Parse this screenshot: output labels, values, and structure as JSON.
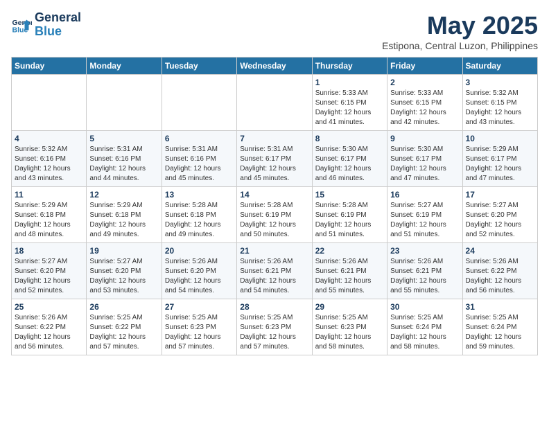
{
  "logo": {
    "line1": "General",
    "line2": "Blue"
  },
  "title": {
    "month_year": "May 2025",
    "location": "Estipona, Central Luzon, Philippines"
  },
  "header": {
    "days": [
      "Sunday",
      "Monday",
      "Tuesday",
      "Wednesday",
      "Thursday",
      "Friday",
      "Saturday"
    ]
  },
  "weeks": [
    [
      {
        "day": "",
        "info": ""
      },
      {
        "day": "",
        "info": ""
      },
      {
        "day": "",
        "info": ""
      },
      {
        "day": "",
        "info": ""
      },
      {
        "day": "1",
        "info": "Sunrise: 5:33 AM\nSunset: 6:15 PM\nDaylight: 12 hours\nand 41 minutes."
      },
      {
        "day": "2",
        "info": "Sunrise: 5:33 AM\nSunset: 6:15 PM\nDaylight: 12 hours\nand 42 minutes."
      },
      {
        "day": "3",
        "info": "Sunrise: 5:32 AM\nSunset: 6:15 PM\nDaylight: 12 hours\nand 43 minutes."
      }
    ],
    [
      {
        "day": "4",
        "info": "Sunrise: 5:32 AM\nSunset: 6:16 PM\nDaylight: 12 hours\nand 43 minutes."
      },
      {
        "day": "5",
        "info": "Sunrise: 5:31 AM\nSunset: 6:16 PM\nDaylight: 12 hours\nand 44 minutes."
      },
      {
        "day": "6",
        "info": "Sunrise: 5:31 AM\nSunset: 6:16 PM\nDaylight: 12 hours\nand 45 minutes."
      },
      {
        "day": "7",
        "info": "Sunrise: 5:31 AM\nSunset: 6:17 PM\nDaylight: 12 hours\nand 45 minutes."
      },
      {
        "day": "8",
        "info": "Sunrise: 5:30 AM\nSunset: 6:17 PM\nDaylight: 12 hours\nand 46 minutes."
      },
      {
        "day": "9",
        "info": "Sunrise: 5:30 AM\nSunset: 6:17 PM\nDaylight: 12 hours\nand 47 minutes."
      },
      {
        "day": "10",
        "info": "Sunrise: 5:29 AM\nSunset: 6:17 PM\nDaylight: 12 hours\nand 47 minutes."
      }
    ],
    [
      {
        "day": "11",
        "info": "Sunrise: 5:29 AM\nSunset: 6:18 PM\nDaylight: 12 hours\nand 48 minutes."
      },
      {
        "day": "12",
        "info": "Sunrise: 5:29 AM\nSunset: 6:18 PM\nDaylight: 12 hours\nand 49 minutes."
      },
      {
        "day": "13",
        "info": "Sunrise: 5:28 AM\nSunset: 6:18 PM\nDaylight: 12 hours\nand 49 minutes."
      },
      {
        "day": "14",
        "info": "Sunrise: 5:28 AM\nSunset: 6:19 PM\nDaylight: 12 hours\nand 50 minutes."
      },
      {
        "day": "15",
        "info": "Sunrise: 5:28 AM\nSunset: 6:19 PM\nDaylight: 12 hours\nand 51 minutes."
      },
      {
        "day": "16",
        "info": "Sunrise: 5:27 AM\nSunset: 6:19 PM\nDaylight: 12 hours\nand 51 minutes."
      },
      {
        "day": "17",
        "info": "Sunrise: 5:27 AM\nSunset: 6:20 PM\nDaylight: 12 hours\nand 52 minutes."
      }
    ],
    [
      {
        "day": "18",
        "info": "Sunrise: 5:27 AM\nSunset: 6:20 PM\nDaylight: 12 hours\nand 52 minutes."
      },
      {
        "day": "19",
        "info": "Sunrise: 5:27 AM\nSunset: 6:20 PM\nDaylight: 12 hours\nand 53 minutes."
      },
      {
        "day": "20",
        "info": "Sunrise: 5:26 AM\nSunset: 6:20 PM\nDaylight: 12 hours\nand 54 minutes."
      },
      {
        "day": "21",
        "info": "Sunrise: 5:26 AM\nSunset: 6:21 PM\nDaylight: 12 hours\nand 54 minutes."
      },
      {
        "day": "22",
        "info": "Sunrise: 5:26 AM\nSunset: 6:21 PM\nDaylight: 12 hours\nand 55 minutes."
      },
      {
        "day": "23",
        "info": "Sunrise: 5:26 AM\nSunset: 6:21 PM\nDaylight: 12 hours\nand 55 minutes."
      },
      {
        "day": "24",
        "info": "Sunrise: 5:26 AM\nSunset: 6:22 PM\nDaylight: 12 hours\nand 56 minutes."
      }
    ],
    [
      {
        "day": "25",
        "info": "Sunrise: 5:26 AM\nSunset: 6:22 PM\nDaylight: 12 hours\nand 56 minutes."
      },
      {
        "day": "26",
        "info": "Sunrise: 5:25 AM\nSunset: 6:22 PM\nDaylight: 12 hours\nand 57 minutes."
      },
      {
        "day": "27",
        "info": "Sunrise: 5:25 AM\nSunset: 6:23 PM\nDaylight: 12 hours\nand 57 minutes."
      },
      {
        "day": "28",
        "info": "Sunrise: 5:25 AM\nSunset: 6:23 PM\nDaylight: 12 hours\nand 57 minutes."
      },
      {
        "day": "29",
        "info": "Sunrise: 5:25 AM\nSunset: 6:23 PM\nDaylight: 12 hours\nand 58 minutes."
      },
      {
        "day": "30",
        "info": "Sunrise: 5:25 AM\nSunset: 6:24 PM\nDaylight: 12 hours\nand 58 minutes."
      },
      {
        "day": "31",
        "info": "Sunrise: 5:25 AM\nSunset: 6:24 PM\nDaylight: 12 hours\nand 59 minutes."
      }
    ]
  ]
}
